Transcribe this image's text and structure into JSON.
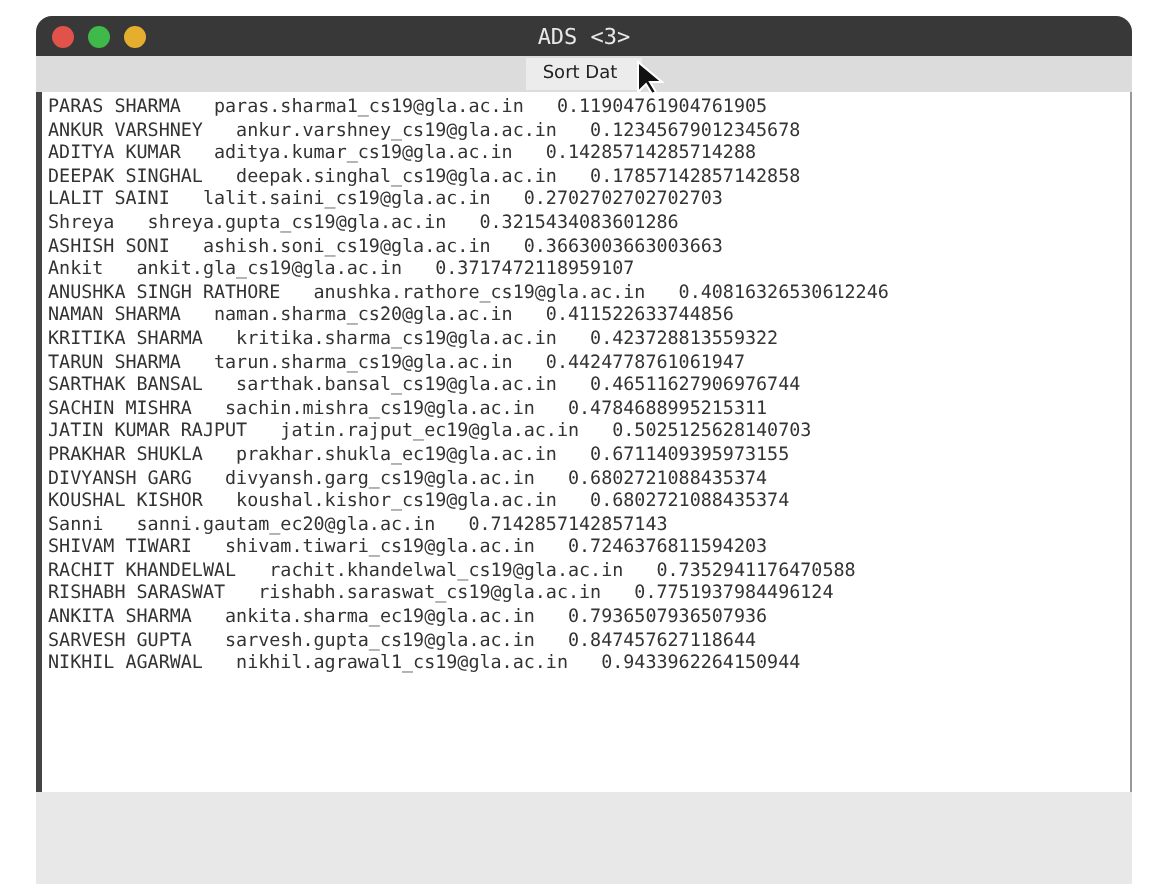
{
  "window": {
    "title": "ADS <3>"
  },
  "toolbar": {
    "button": "Sort Dat"
  },
  "lines": [
    "PARAS SHARMA   paras.sharma1_cs19@gla.ac.in   0.11904761904761905",
    "ANKUR VARSHNEY   ankur.varshney_cs19@gla.ac.in   0.12345679012345678",
    "ADITYA KUMAR   aditya.kumar_cs19@gla.ac.in   0.14285714285714288",
    "DEEPAK SINGHAL   deepak.singhal_cs19@gla.ac.in   0.17857142857142858",
    "LALIT SAINI   lalit.saini_cs19@gla.ac.in   0.2702702702702703",
    "Shreya   shreya.gupta_cs19@gla.ac.in   0.3215434083601286",
    "ASHISH SONI   ashish.soni_cs19@gla.ac.in   0.3663003663003663",
    "Ankit   ankit.gla_cs19@gla.ac.in   0.3717472118959107",
    "ANUSHKA SINGH RATHORE   anushka.rathore_cs19@gla.ac.in   0.40816326530612246",
    "NAMAN SHARMA   naman.sharma_cs20@gla.ac.in   0.411522633744856",
    "KRITIKA SHARMA   kritika.sharma_cs19@gla.ac.in   0.423728813559322",
    "TARUN SHARMA   tarun.sharma_cs19@gla.ac.in   0.4424778761061947",
    "SARTHAK BANSAL   sarthak.bansal_cs19@gla.ac.in   0.46511627906976744",
    "SACHIN MISHRA   sachin.mishra_cs19@gla.ac.in   0.4784688995215311",
    "JATIN KUMAR RAJPUT   jatin.rajput_ec19@gla.ac.in   0.5025125628140703",
    "PRAKHAR SHUKLA   prakhar.shukla_ec19@gla.ac.in   0.6711409395973155",
    "DIVYANSH GARG   divyansh.garg_cs19@gla.ac.in   0.6802721088435374",
    "KOUSHAL KISHOR   koushal.kishor_cs19@gla.ac.in   0.6802721088435374",
    "Sanni   sanni.gautam_ec20@gla.ac.in   0.7142857142857143",
    "SHIVAM TIWARI   shivam.tiwari_cs19@gla.ac.in   0.7246376811594203",
    "RACHIT KHANDELWAL   rachit.khandelwal_cs19@gla.ac.in   0.7352941176470588",
    "RISHABH SARASWAT   rishabh.saraswat_cs19@gla.ac.in   0.7751937984496124",
    "ANKITA SHARMA   ankita.sharma_ec19@gla.ac.in   0.7936507936507936",
    "SARVESH GUPTA   sarvesh.gupta_cs19@gla.ac.in   0.847457627118644",
    "NIKHIL AGARWAL   nikhil.agrawal1_cs19@gla.ac.in   0.9433962264150944"
  ]
}
